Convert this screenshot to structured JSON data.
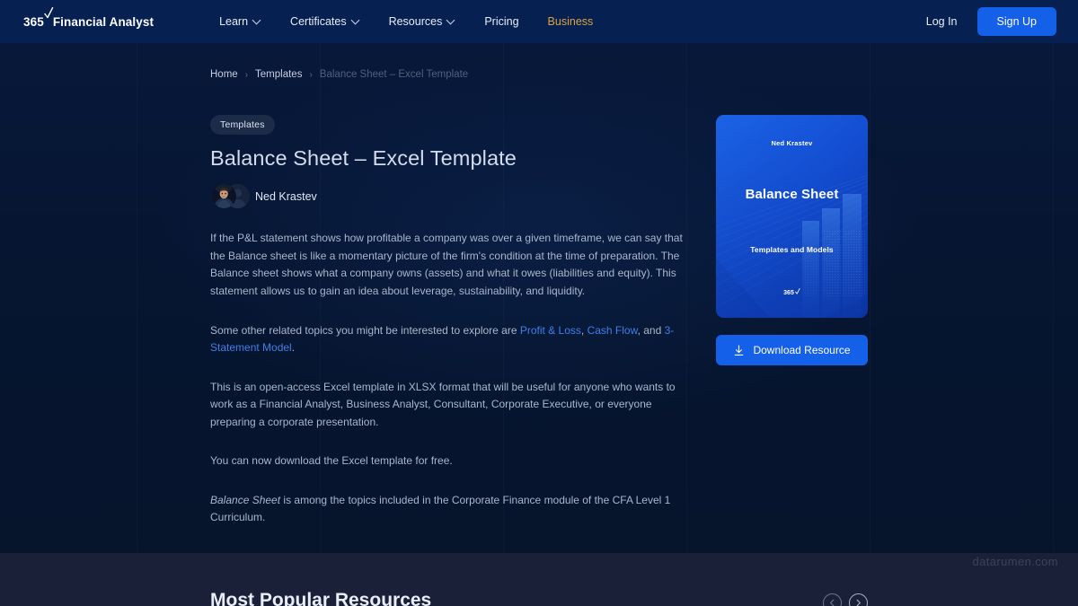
{
  "nav": {
    "brand_365": "365",
    "brand_name": "Financial Analyst",
    "links": [
      {
        "label": "Learn",
        "has_chevron": true,
        "accent": false
      },
      {
        "label": "Certificates",
        "has_chevron": true,
        "accent": false
      },
      {
        "label": "Resources",
        "has_chevron": true,
        "accent": false
      },
      {
        "label": "Pricing",
        "has_chevron": false,
        "accent": false
      },
      {
        "label": "Business",
        "has_chevron": false,
        "accent": true
      }
    ],
    "login_label": "Log In",
    "signup_label": "Sign Up",
    "accent_color": "#d9a441",
    "button_color": "#1560e8"
  },
  "breadcrumb": {
    "home": "Home",
    "templates": "Templates",
    "current": "Balance Sheet – Excel Template",
    "separator": "›"
  },
  "hero": {
    "tag": "Templates",
    "title": "Balance Sheet – Excel Template",
    "author": "Ned Krastev",
    "paragraph_1": "If the P&L statement shows how profitable a company was over a given timeframe, we can say that the Balance sheet is like a momentary picture of the firm's condition at the time of preparation. The Balance sheet shows what a company owns (assets) and what it owes (liabilities and equity). This statement allows us to gain an idea about leverage, sustainability, and liquidity.",
    "paragraph_2_prefix": "Some other related topics you might be interested to explore are ",
    "link_1": "Profit & Loss",
    "paragraph_2_sep1": ", ",
    "link_2": "Cash Flow",
    "paragraph_2_sep2": ", and ",
    "link_3": "3-Statement Model",
    "paragraph_2_suffix": ".",
    "paragraph_3": "This is an open-access Excel template in XLSX format that will be useful for anyone who wants to work as a Financial Analyst, Business Analyst, Consultant, Corporate Executive, or everyone preparing a corporate presentation.",
    "paragraph_4": "You can now download the Excel template for free.",
    "paragraph_5_italic": "Balance Sheet",
    "paragraph_5_rest": " is among the topics included in the Corporate Finance module of the CFA Level 1 Curriculum.",
    "link_color": "#3f7fe8"
  },
  "thumbnail": {
    "author": "Ned Krastev",
    "title": "Balance Sheet",
    "subtitle": "Templates and Models",
    "logo_365": "365"
  },
  "download": {
    "label": "Download Resource",
    "icon": "download-icon"
  },
  "lower": {
    "section_title": "Most Popular Resources",
    "prev_label": "‹",
    "next_label": "›"
  },
  "watermark": {
    "text": "datarumen.com"
  }
}
